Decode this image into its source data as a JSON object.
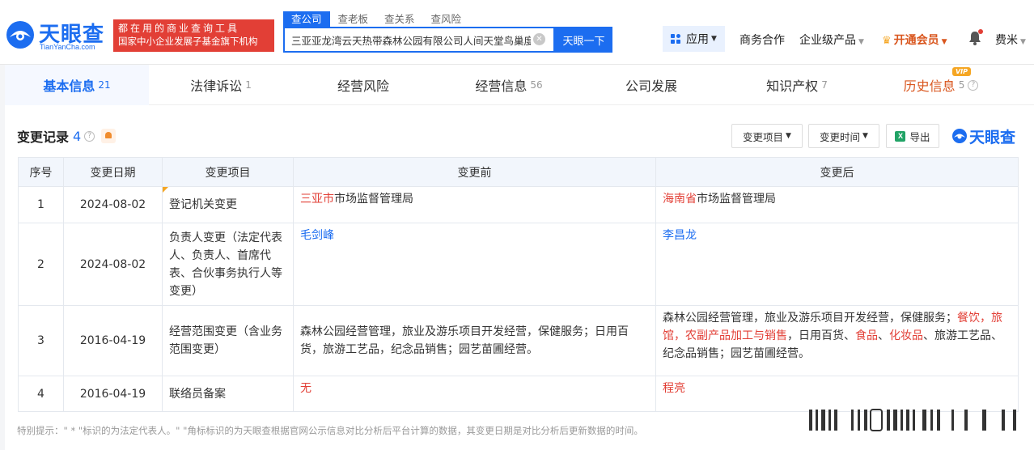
{
  "header": {
    "logo_text": "天眼查",
    "logo_sub": "TianYanCha.com",
    "promo_line1": "都在用的商业查询工具",
    "promo_line2": "国家中小企业发展子基金旗下机构",
    "search_tabs": [
      "查公司",
      "查老板",
      "查关系",
      "查风险"
    ],
    "search_value": "三亚亚龙湾云天热带森林公园有限公司人间天堂鸟巢度",
    "search_button": "天眼一下",
    "app_label": "应用",
    "business": "商务合作",
    "enterprise": "企业级产品",
    "vip": "开通会员",
    "user": "费米"
  },
  "tabs": [
    {
      "label": "基本信息",
      "count": "21"
    },
    {
      "label": "法律诉讼",
      "count": "1"
    },
    {
      "label": "经营风险",
      "count": ""
    },
    {
      "label": "经营信息",
      "count": "56"
    },
    {
      "label": "公司发展",
      "count": ""
    },
    {
      "label": "知识产权",
      "count": "7"
    },
    {
      "label": "历史信息",
      "count": "5"
    }
  ],
  "vip_badge": "VIP",
  "section": {
    "title": "变更记录",
    "count": "4",
    "filter_project": "变更项目",
    "filter_time": "变更时间",
    "export": "导出",
    "brand": "天眼查"
  },
  "table": {
    "headers": [
      "序号",
      "变更日期",
      "变更项目",
      "变更前",
      "变更后"
    ],
    "rows": [
      {
        "no": "1",
        "date": "2024-08-02",
        "item": "登记机关变更",
        "before": [
          {
            "t": "三亚市",
            "c": "red"
          },
          {
            "t": "市场监督管理局",
            "c": ""
          }
        ],
        "after": [
          {
            "t": "海南省",
            "c": "red"
          },
          {
            "t": "市场监督管理局",
            "c": ""
          }
        ]
      },
      {
        "no": "2",
        "date": "2024-08-02",
        "item": "负责人变更（法定代表人、负责人、首席代表、合伙事务执行人等变更）",
        "before": [
          {
            "t": "毛剑峰",
            "c": "blue"
          }
        ],
        "after": [
          {
            "t": "李昌龙",
            "c": "blue"
          }
        ]
      },
      {
        "no": "3",
        "date": "2016-04-19",
        "item": "经营范围变更（含业务范围变更）",
        "before": [
          {
            "t": "森林公园经营管理，旅业及游乐项目开发经营，保健服务；日用百货，旅游工艺品，纪念品销售；园艺苗圃经营。",
            "c": ""
          }
        ],
        "after": [
          {
            "t": "森林公园经营管理，旅业及游乐项目开发经营，保健服务；",
            "c": ""
          },
          {
            "t": "餐饮，旅馆，农副产品加工与销售",
            "c": "red"
          },
          {
            "t": "，日用百货、",
            "c": ""
          },
          {
            "t": "食品",
            "c": "red"
          },
          {
            "t": "、",
            "c": ""
          },
          {
            "t": "化妆品",
            "c": "red"
          },
          {
            "t": "、旅游工艺品、纪念品销售；园艺苗圃经营。",
            "c": ""
          }
        ]
      },
      {
        "no": "4",
        "date": "2016-04-19",
        "item": "联络员备案",
        "before": [
          {
            "t": "无",
            "c": "red"
          }
        ],
        "after": [
          {
            "t": "程亮",
            "c": "red"
          }
        ]
      }
    ]
  },
  "footnote": "特别提示：\" * \"标识的为法定代表人。\" \"角标标识的为天眼查根据官网公示信息对比分析后平台计算的数据，其变更日期是对比分析后更新数据的时间。",
  "colors": {
    "brand": "#1c6df0",
    "red": "#e23f36",
    "orange": "#d9561e"
  }
}
